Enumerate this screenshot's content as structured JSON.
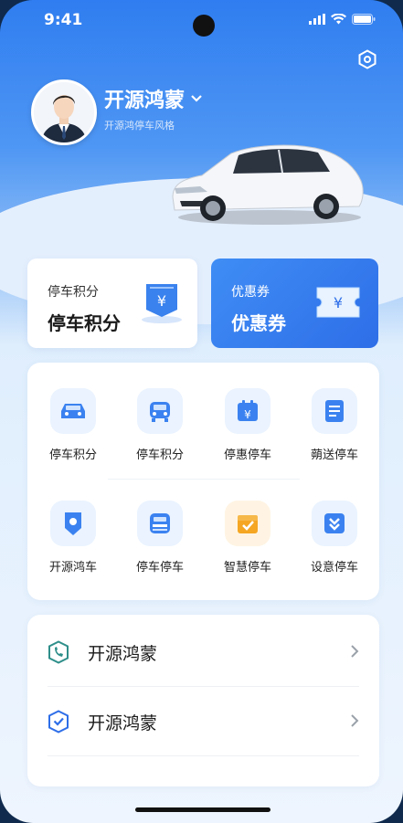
{
  "status": {
    "time": "9:41"
  },
  "profile": {
    "name": "开源鸿蒙",
    "subtitle": "开源鸿停车风格"
  },
  "cards": [
    {
      "small": "停车积分",
      "big": "停车积分",
      "icon": "ticket-yen-icon"
    },
    {
      "small": "优惠券",
      "big": "优惠券",
      "icon": "coupon-yen-icon"
    }
  ],
  "grid": [
    {
      "label": "停车积分",
      "icon": "car-icon"
    },
    {
      "label": "停车积分",
      "icon": "car-front-icon"
    },
    {
      "label": "停惠停车",
      "icon": "calendar-yen-icon"
    },
    {
      "label": "蒴送停车",
      "icon": "document-icon"
    },
    {
      "label": "开源鸿车",
      "icon": "location-pin-icon"
    },
    {
      "label": "停车停车",
      "icon": "garage-icon"
    },
    {
      "label": "智慧停车",
      "icon": "gift-box-icon"
    },
    {
      "label": "设意停车",
      "icon": "download-box-icon"
    }
  ],
  "list": [
    {
      "label": "开源鸿蒙",
      "icon": "phone-shield-icon"
    },
    {
      "label": "开源鸿蒙",
      "icon": "shield-check-icon"
    }
  ],
  "colors": {
    "primary": "#2e6ee8",
    "accent_orange": "#f5a623",
    "card_bg": "#ffffff"
  }
}
